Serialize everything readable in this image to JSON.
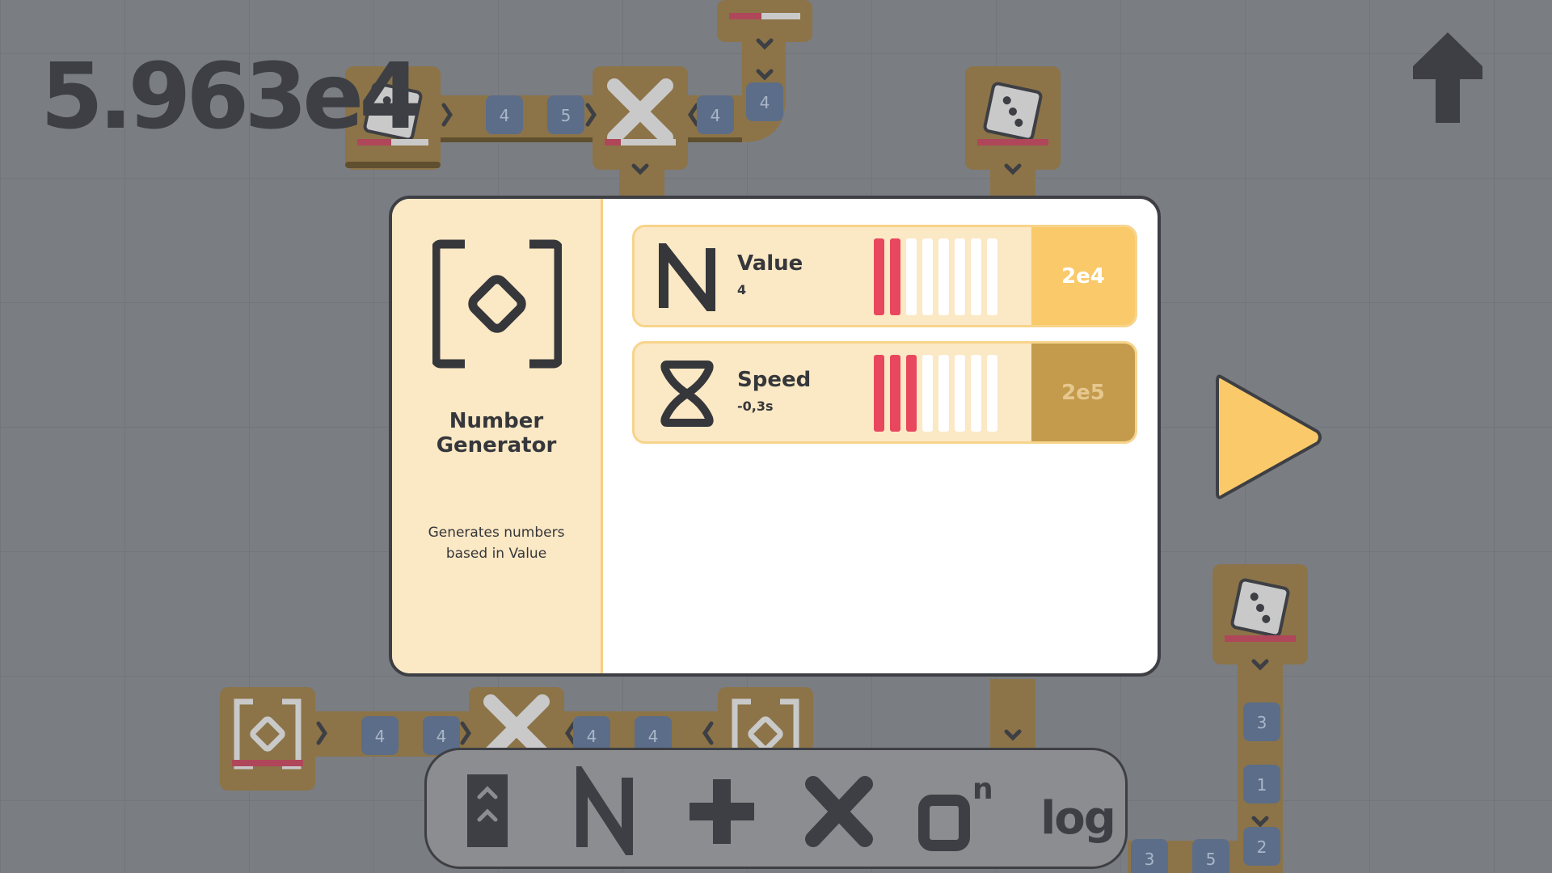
{
  "hud": {
    "score": "5.963e4",
    "upgrade_icon": "up-arrow-icon",
    "play_icon": "play-icon"
  },
  "colors": {
    "background": "#7a7d82",
    "tile": "#8c7448",
    "modal_panel": "#fbe8c4",
    "bar_filled": "#e8475e",
    "cost_affordable": "#f9c96a",
    "cost_locked": "#c49a4c",
    "play": "#f9c96a"
  },
  "board": {
    "number_chips": [
      "4",
      "5",
      "4",
      "4",
      "4",
      "4",
      "4",
      "4",
      "3",
      "1",
      "2",
      "3",
      "5"
    ],
    "tile_icons": [
      "dice-icon",
      "multiply-icon",
      "dice-icon",
      "dice-icon",
      "generator-icon",
      "multiply-icon",
      "generator-icon",
      "dice-icon"
    ]
  },
  "modal": {
    "title": "Number Generator",
    "description": "Generates numbers based in Value",
    "icon": "number-generator-icon",
    "stats": [
      {
        "name": "Value",
        "value": "4",
        "icon": "n-icon",
        "level": 2,
        "max_level": 8,
        "cost": "2e4",
        "affordable": true
      },
      {
        "name": "Speed",
        "value": "-0,3s",
        "icon": "hourglass-icon",
        "level": 3,
        "max_level": 8,
        "cost": "2e5",
        "affordable": false
      }
    ]
  },
  "toolbar": {
    "tools": [
      {
        "name": "conveyor-tool",
        "icon": "conveyor-icon"
      },
      {
        "name": "generator-tool",
        "icon": "n-icon"
      },
      {
        "name": "add-tool",
        "icon": "plus-icon"
      },
      {
        "name": "multiply-tool",
        "icon": "multiply-icon"
      },
      {
        "name": "power-tool",
        "icon": "power-icon",
        "label": "n"
      },
      {
        "name": "log-tool",
        "icon": "log-icon",
        "label": "log"
      }
    ]
  }
}
